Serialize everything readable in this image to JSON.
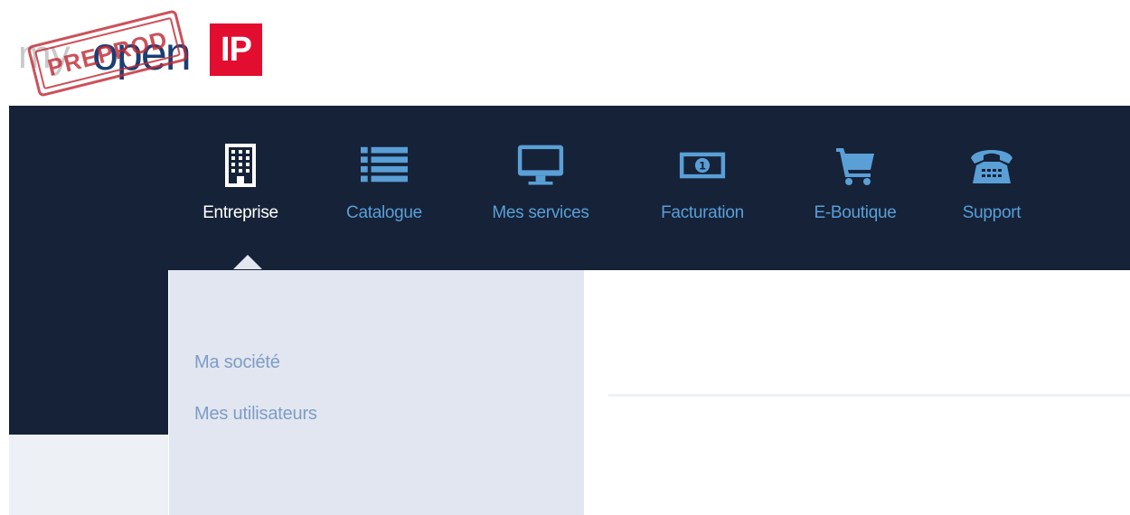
{
  "brand": {
    "prefix": "my",
    "name": "open",
    "badge": "IP",
    "stamp": "PREPROD",
    "colors": {
      "badge": "#e30d2f",
      "name": "#1b3e73",
      "stamp": "#c32a35"
    }
  },
  "nav": {
    "items": [
      {
        "label": "Entreprise",
        "icon": "building-icon",
        "active": true
      },
      {
        "label": "Catalogue",
        "icon": "list-icon",
        "active": false
      },
      {
        "label": "Mes services",
        "icon": "monitor-icon",
        "active": false
      },
      {
        "label": "Facturation",
        "icon": "banknote-icon",
        "active": false
      },
      {
        "label": "E-Boutique",
        "icon": "cart-icon",
        "active": false
      },
      {
        "label": "Support",
        "icon": "telephone-icon",
        "active": false
      }
    ],
    "colors": {
      "background": "#152238",
      "icon": "#5a9fd6",
      "active_label": "#ffffff"
    }
  },
  "dropdown": {
    "items": [
      {
        "label": "Ma société"
      },
      {
        "label": "Mes utilisateurs"
      }
    ],
    "colors": {
      "background": "#e1e6f0",
      "text": "#7f9cc5"
    }
  }
}
